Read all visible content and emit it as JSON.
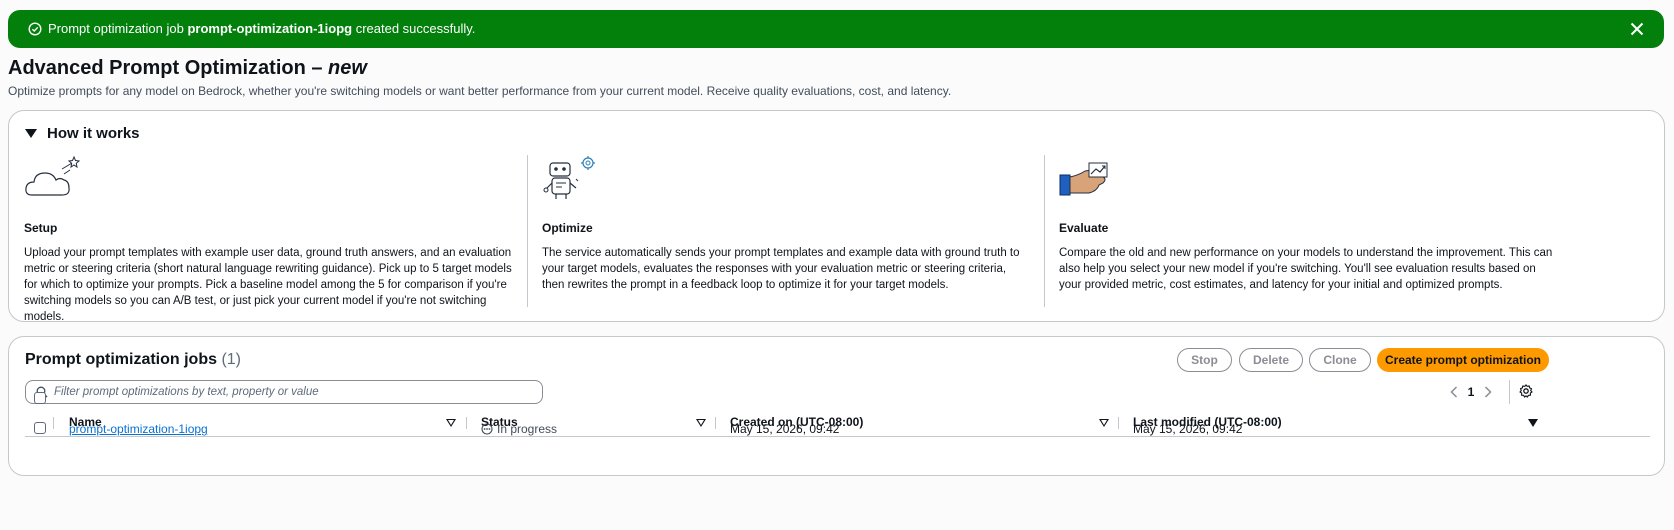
{
  "flash": {
    "prefix": "Prompt optimization job ",
    "job_name": "prompt-optimization-1iopg",
    "suffix": " created successfully."
  },
  "page": {
    "title": "Advanced Prompt Optimization – ",
    "title_badge": "new",
    "description": "Optimize prompts for any model on Bedrock, whether you're switching models or want better performance from your current model. Receive quality evaluations, cost, and latency."
  },
  "how_it_works": {
    "title": "How it works",
    "steps": [
      {
        "title": "Setup",
        "icon": "cloud-sparkle-icon",
        "body": "Upload your prompt templates with example user data, ground truth answers, and an evaluation metric or steering criteria (short natural language rewriting guidance). Pick up to 5 target models for which to optimize your prompts. Pick a baseline model among the 5 for comparison if you're switching models so you can A/B test, or just pick your current model if you're not switching models."
      },
      {
        "title": "Optimize",
        "icon": "robot-gear-icon",
        "body": "The service automatically sends your prompt templates and example data with ground truth to your target models, evaluates the responses with your evaluation metric or steering criteria, then rewrites the prompt in a feedback loop to optimize it for your target models."
      },
      {
        "title": "Evaluate",
        "icon": "hand-chart-icon",
        "body": "Compare the old and new performance on your models to understand the improvement. This can also help you select your new model if you're switching. You'll see evaluation results based on your provided metric, cost estimates, and latency for your initial and optimized prompts."
      }
    ]
  },
  "jobs": {
    "title": "Prompt optimization jobs",
    "count": "(1)",
    "buttons": {
      "stop": "Stop",
      "delete": "Delete",
      "clone": "Clone",
      "create": "Create prompt optimization"
    },
    "search_placeholder": "Filter prompt optimizations by text, property or value",
    "page_number": "1",
    "columns": [
      "Name",
      "Status",
      "Created on (UTC-08:00)",
      "Last modified (UTC-08:00)"
    ],
    "rows": [
      {
        "name": "prompt-optimization-1iopg",
        "status": "In progress",
        "created": "May 15, 2026, 09:42",
        "modified": "May 15, 2026, 09:42"
      }
    ]
  },
  "colors": {
    "success": "#037f0c",
    "primary_button": "#ff9900",
    "link": "#0972d3"
  }
}
